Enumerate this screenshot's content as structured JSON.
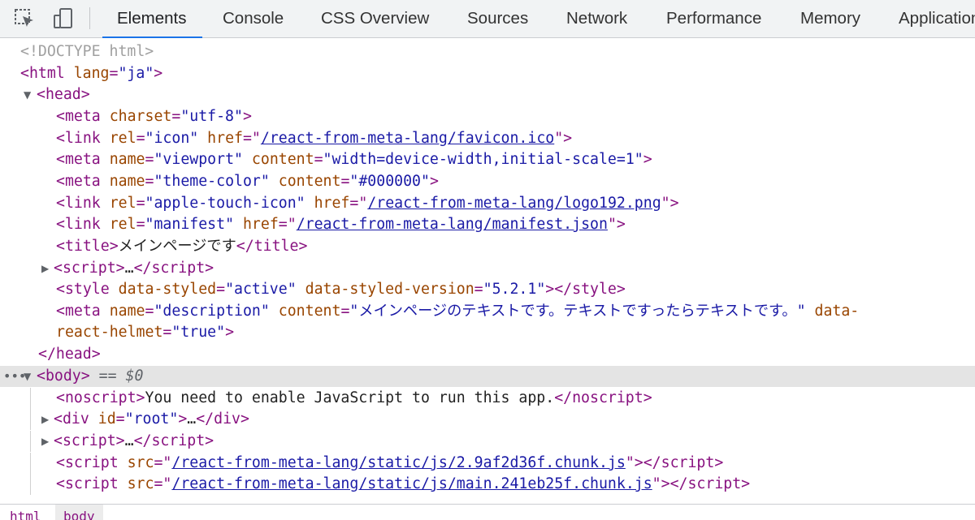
{
  "toolbar": {
    "icons": {
      "inspect": "inspect-element-icon",
      "device": "device-toolbar-icon"
    },
    "tabs": [
      "Elements",
      "Console",
      "CSS Overview",
      "Sources",
      "Network",
      "Performance",
      "Memory",
      "Application"
    ],
    "active_tab": "Elements"
  },
  "tree": {
    "doctype": "<!DOCTYPE html>",
    "html_lang": "\"ja\"",
    "meta_charset": "\"utf-8\"",
    "icon_rel": "\"icon\"",
    "icon_href": "/react-from-meta-lang/favicon.ico",
    "viewport_name": "\"viewport\"",
    "viewport_content": "\"width=device-width,initial-scale=1\"",
    "theme_name": "\"theme-color\"",
    "theme_content": "\"#000000\"",
    "apple_rel": "\"apple-touch-icon\"",
    "apple_href": "/react-from-meta-lang/logo192.png",
    "manifest_rel": "\"manifest\"",
    "manifest_href": "/react-from-meta-lang/manifest.json",
    "title_text": "メインページです",
    "collapsed_ellipsis": "…",
    "style_data_styled": "\"active\"",
    "style_version": "\"5.2.1\"",
    "desc_name": "\"description\"",
    "desc_content": "\"メインページのテキストです。テキストですったらテキストです。\"",
    "desc_helmet": "\"true\"",
    "body_marker": "== $0",
    "noscript_text": "You need to enable JavaScript to run this app.",
    "div_id": "\"root\"",
    "chunk_src_1": "/react-from-meta-lang/static/js/2.9af2d36f.chunk.js",
    "chunk_src_2": "/react-from-meta-lang/static/js/main.241eb25f.chunk.js"
  },
  "breadcrumbs": [
    "html",
    "body"
  ]
}
